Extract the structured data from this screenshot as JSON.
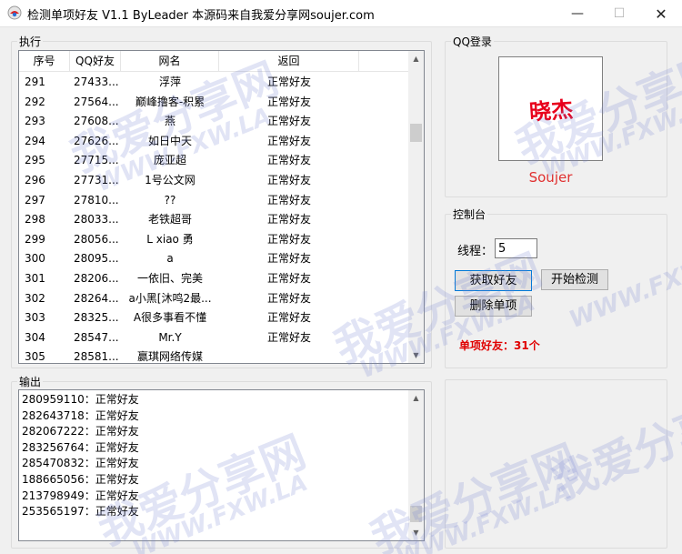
{
  "window": {
    "title": "检测单项好友  V1.1   ByLeader  本源码来自我爱分享网soujer.com",
    "minimize_glyph": "—",
    "maximize_glyph": "☐",
    "close_glyph": "✕"
  },
  "exec_group": {
    "legend": "执行",
    "columns": [
      "序号",
      "QQ好友",
      "网名",
      "返回"
    ],
    "rows": [
      {
        "no": "291",
        "qq": "27433...",
        "name": "浮萍",
        "result": "正常好友"
      },
      {
        "no": "292",
        "qq": "27564...",
        "name": "巅峰撸客-积累",
        "result": "正常好友"
      },
      {
        "no": "293",
        "qq": "27608...",
        "name": "燕",
        "result": "正常好友"
      },
      {
        "no": "294",
        "qq": "27626...",
        "name": "如日中天",
        "result": "正常好友"
      },
      {
        "no": "295",
        "qq": "27715...",
        "name": "庞亚超",
        "result": "正常好友"
      },
      {
        "no": "296",
        "qq": "27731...",
        "name": "1号公文网",
        "result": "正常好友"
      },
      {
        "no": "297",
        "qq": "27810...",
        "name": "??",
        "result": "正常好友"
      },
      {
        "no": "298",
        "qq": "28033...",
        "name": "老铁超哥",
        "result": "正常好友"
      },
      {
        "no": "299",
        "qq": "28056...",
        "name": "L  xiao  勇",
        "result": "正常好友"
      },
      {
        "no": "300",
        "qq": "28095...",
        "name": "a",
        "result": "正常好友"
      },
      {
        "no": "301",
        "qq": "28206...",
        "name": "一依旧、完美",
        "result": "正常好友"
      },
      {
        "no": "302",
        "qq": "28264...",
        "name": "a小黑[沐鸣2最...",
        "result": "正常好友"
      },
      {
        "no": "303",
        "qq": "28325...",
        "name": "A很多事看不懂",
        "result": "正常好友"
      },
      {
        "no": "304",
        "qq": "28547...",
        "name": "Mr.Y",
        "result": "正常好友"
      },
      {
        "no": "305",
        "qq": "28581...",
        "name": "赢琪网络传媒",
        "result": ""
      }
    ]
  },
  "output_group": {
    "legend": "输出",
    "lines": [
      "280959110：正常好友",
      "282643718：正常好友",
      "282067222：正常好友",
      "283256764：正常好友",
      "285470832：正常好友",
      "188665056：正常好友",
      "213798949：正常好友",
      "253565197：正常好友"
    ]
  },
  "qq_login": {
    "legend": "QQ登录",
    "avatar_text": "晓杰",
    "nickname": "Soujer"
  },
  "console": {
    "legend": "控制台",
    "threads_label": "线程：",
    "threads_value": "5",
    "get_friends_label": "获取好友",
    "start_check_label": "开始检测",
    "delete_single_label": "删除单项",
    "single_friends_text": "单项好友：31个"
  },
  "watermark": {
    "cn": "我爱分享网",
    "en": "WWW.FXW.LA"
  },
  "colors": {
    "accent_red": "#e00000",
    "nick_red": "#e03030",
    "focus_blue": "#0078d7"
  }
}
